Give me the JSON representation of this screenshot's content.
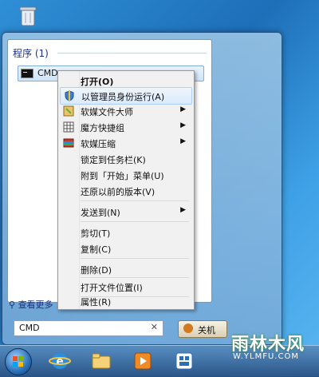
{
  "start_menu": {
    "section_title": "程序 (1)",
    "result_label": "CMD",
    "see_more": "查看更多",
    "search_value": "CMD",
    "shutdown_label": "关机"
  },
  "context_menu": {
    "items": [
      {
        "label": "打开(O)"
      },
      {
        "label": "以管理员身份运行(A)"
      },
      {
        "label": "软媒文件大师"
      },
      {
        "label": "魔方快捷组"
      },
      {
        "label": "软媒压缩"
      },
      {
        "label": "锁定到任务栏(K)"
      },
      {
        "label": "附到「开始」菜单(U)"
      },
      {
        "label": "还原以前的版本(V)"
      },
      {
        "label": "发送到(N)"
      },
      {
        "label": "剪切(T)"
      },
      {
        "label": "复制(C)"
      },
      {
        "label": "删除(D)"
      },
      {
        "label": "打开文件位置(I)"
      },
      {
        "label": "属性(R)"
      }
    ]
  },
  "watermark": {
    "title": "雨林木风",
    "url": "W.YLMFU.COM"
  },
  "colors": {
    "accent": "#1e3287",
    "hover": "#dbeafb",
    "desktop": "#1d6fb8"
  }
}
